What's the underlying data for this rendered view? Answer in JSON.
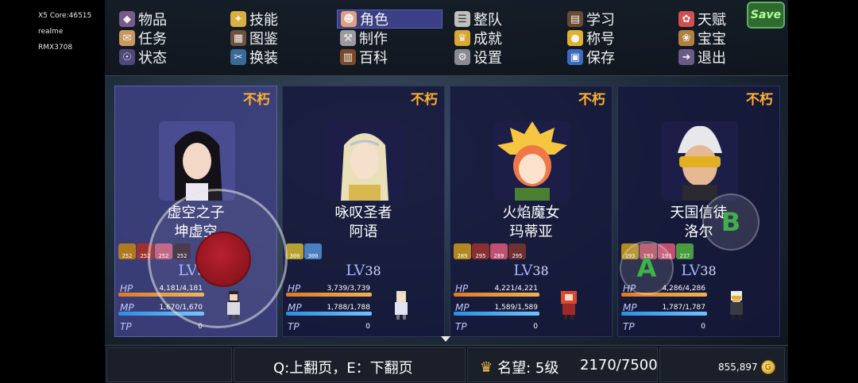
{
  "device": {
    "core": "X5 Core:46515",
    "brand": "realme",
    "model": "RMX3708"
  },
  "menu": {
    "items": [
      {
        "label": "物品",
        "icon": "bag-icon"
      },
      {
        "label": "技能",
        "icon": "skill-icon"
      },
      {
        "label": "角色",
        "icon": "mask-icon"
      },
      {
        "label": "整队",
        "icon": "formation-icon"
      },
      {
        "label": "学习",
        "icon": "book-icon"
      },
      {
        "label": "天赋",
        "icon": "talent-icon"
      },
      {
        "label": "任务",
        "icon": "scroll-icon"
      },
      {
        "label": "图鉴",
        "icon": "codex-icon"
      },
      {
        "label": "制作",
        "icon": "craft-icon"
      },
      {
        "label": "成就",
        "icon": "trophy-icon"
      },
      {
        "label": "称号",
        "icon": "medal-icon"
      },
      {
        "label": "宝宝",
        "icon": "pet-icon"
      },
      {
        "label": "状态",
        "icon": "status-icon"
      },
      {
        "label": "换装",
        "icon": "outfit-icon"
      },
      {
        "label": "百科",
        "icon": "encyclopedia-icon"
      },
      {
        "label": "设置",
        "icon": "gear-icon"
      },
      {
        "label": "保存",
        "icon": "floppy-icon"
      },
      {
        "label": "退出",
        "icon": "exit-icon"
      }
    ],
    "active": "角色",
    "save_button": "Save"
  },
  "party": [
    {
      "tag": "不朽",
      "title": "虚空之子",
      "name": "坤虚空",
      "buffs": [
        "252",
        "252",
        "252",
        "252"
      ],
      "level": "38",
      "lv_label": "LV",
      "hp": "4,181/4,181",
      "hp_ratio": 1.0,
      "mp": "1,670/1,670",
      "mp_ratio": 1.0,
      "tp": "0",
      "active": true
    },
    {
      "tag": "不朽",
      "title": "咏叹圣者",
      "name": "阿语",
      "buffs": [
        "300",
        "300"
      ],
      "level": "38",
      "lv_label": "LV",
      "hp": "3,739/3,739",
      "hp_ratio": 1.0,
      "mp": "1,788/1,788",
      "mp_ratio": 1.0,
      "tp": "0",
      "active": false
    },
    {
      "tag": "不朽",
      "title": "火焰魔女",
      "name": "玛蒂亚",
      "buffs": [
        "289",
        "295",
        "289",
        "295"
      ],
      "level": "38",
      "lv_label": "LV",
      "hp": "4,221/4,221",
      "hp_ratio": 1.0,
      "mp": "1,589/1,589",
      "mp_ratio": 1.0,
      "tp": "0",
      "active": false
    },
    {
      "tag": "不朽",
      "title": "天国信徒",
      "name": "洛尔",
      "buffs": [
        "193",
        "193",
        "193",
        "217"
      ],
      "level": "38",
      "lv_label": "LV",
      "hp": "4,286/4,286",
      "hp_ratio": 1.0,
      "mp": "1,787/1,787",
      "mp_ratio": 1.0,
      "tp": "0",
      "active": false
    }
  ],
  "stat_labels": {
    "hp": "HP",
    "mp": "MP",
    "tp": "TP"
  },
  "footer": {
    "hint": "Q:上翻页，E：下翻页",
    "fame_label": "名望: 5级",
    "fame_value": "2170/7500",
    "gold": "855,897"
  },
  "controls": {
    "a": "A",
    "b": "B"
  },
  "colors": {
    "accent": "#3b3f85",
    "tag": "#ffb030",
    "hp": "#e27a20",
    "mp": "#2d8ee0"
  }
}
